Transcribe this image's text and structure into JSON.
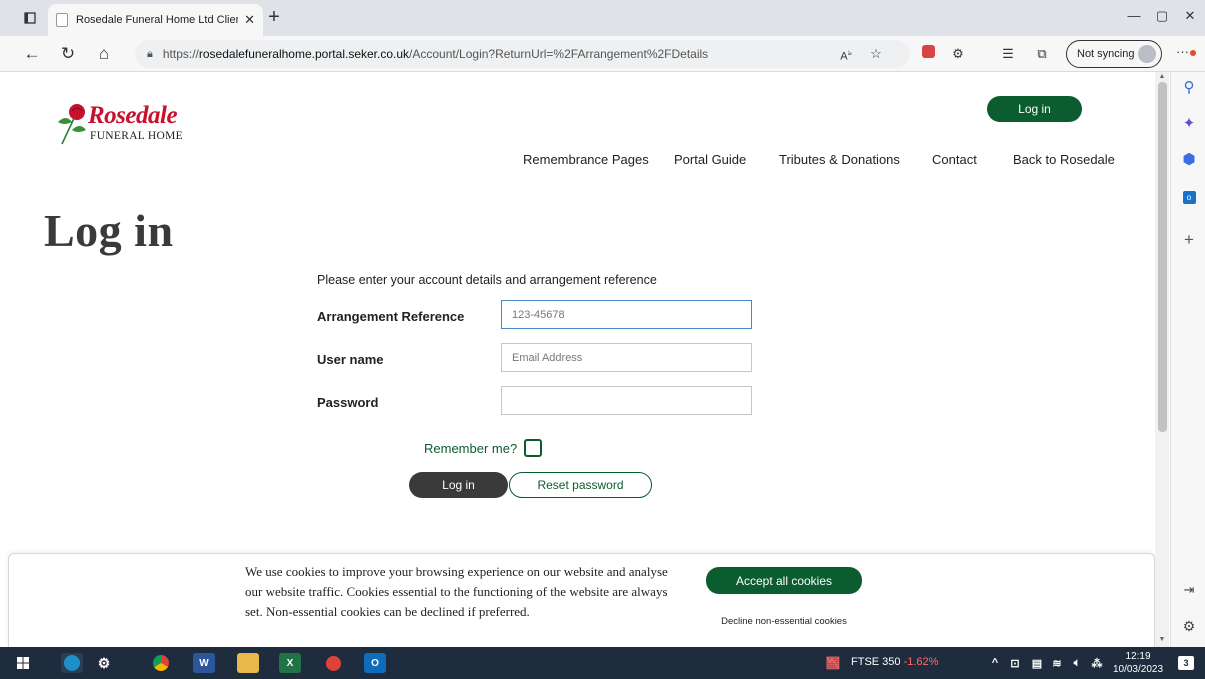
{
  "browser": {
    "tab_title": "Rosedale Funeral Home Ltd Clien",
    "url_prefix": "https://",
    "url_host": "rosedalefuneralhome.portal.seker.co.uk",
    "url_path": "/Account/Login?ReturnUrl=%2FArrangement%2FDetails",
    "sync_label": "Not syncing",
    "read_aloud": "A̅",
    "sidebar_icons": [
      "search-icon",
      "copilot-icon",
      "office-icon",
      "outlook-icon",
      "add-icon"
    ]
  },
  "site": {
    "brand_name": "Rosedale",
    "brand_sub": "FUNERAL HOME",
    "header_login": "Log in",
    "nav": [
      "Remembrance Pages",
      "Portal Guide",
      "Tributes & Donations",
      "Contact",
      "Back to Rosedale"
    ]
  },
  "login": {
    "title": "Log in",
    "intro": "Please enter your account details and arrangement reference",
    "arrangement_label": "Arrangement Reference",
    "arrangement_placeholder": "123-45678",
    "username_label": "User name",
    "username_placeholder": "Email Address",
    "password_label": "Password",
    "remember_label": "Remember me?",
    "remember_checked": false,
    "login_button": "Log in",
    "reset_button": "Reset password"
  },
  "cookie": {
    "text": "We use cookies to improve your browsing experience on our website and analyse our website traffic. Cookies essential to the functioning of the website are always set. Non-essential cookies can be declined if preferred.",
    "accept": "Accept all cookies",
    "decline": "Decline non-essential cookies"
  },
  "taskbar": {
    "ticker_name": "FTSE 350",
    "ticker_change": "-1.62%",
    "time": "12:19",
    "date": "10/03/2023",
    "notifications": "3"
  },
  "colors": {
    "brand_green": "#0b5c2f",
    "brand_red": "#c8102e",
    "dark_button": "#3a3a3a",
    "taskbar": "#1f2c3d"
  }
}
